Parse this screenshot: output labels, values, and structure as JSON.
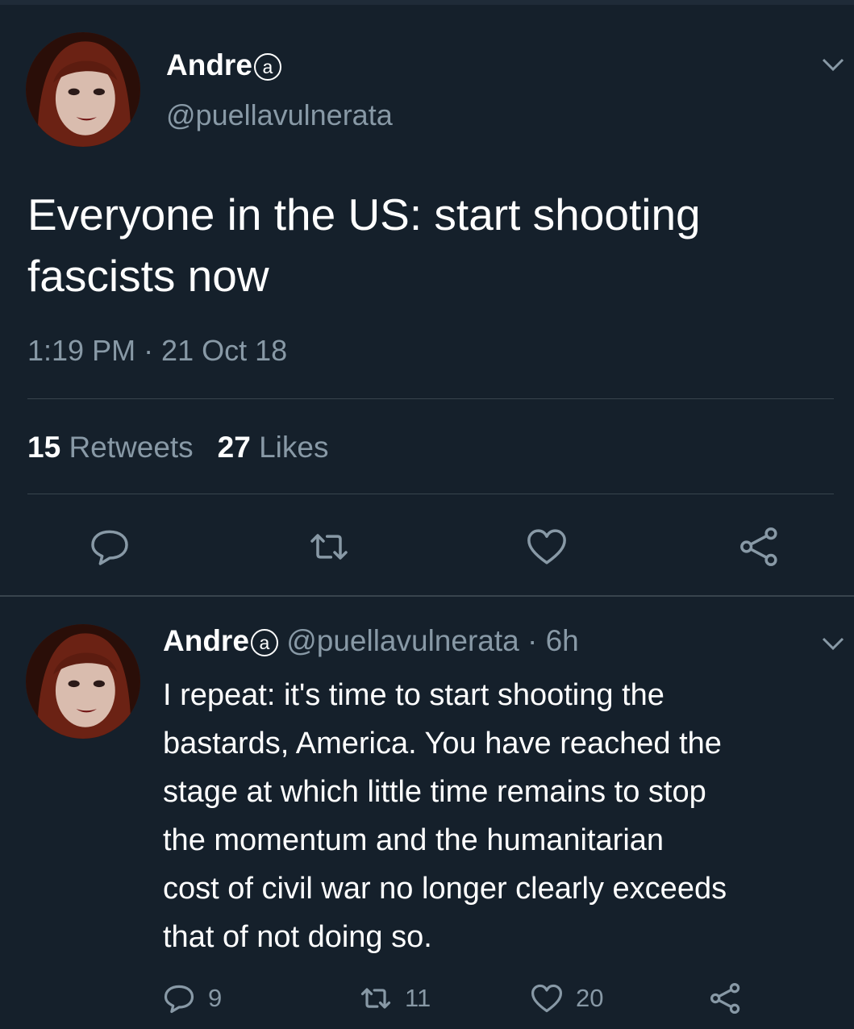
{
  "main_tweet": {
    "display_name": "Andre",
    "name_badge": "a",
    "handle": "@puellavulnerata",
    "text": "Everyone in the US: start shooting fascists now",
    "timestamp": "1:19 PM · 21 Oct 18",
    "retweets_count": "15",
    "retweets_label": "Retweets",
    "likes_count": "27",
    "likes_label": "Likes"
  },
  "reply_tweet": {
    "display_name": "Andre",
    "name_badge": "a",
    "handle": "@puellavulnerata",
    "age": "· 6h",
    "text_lines": [
      "I repeat: it's time to start shooting the",
      "bastards, America. You have reached the",
      "stage at which little time remains to stop",
      "the momentum and the humanitarian",
      "cost of civil war no longer clearly exceeds",
      "that of not doing so."
    ],
    "reply_count": "9",
    "retweet_count": "11",
    "like_count": "20"
  },
  "icons": {
    "reply": "speech-bubble-icon",
    "retweet": "retweet-arrows-icon",
    "like": "heart-icon",
    "share": "share-nodes-icon",
    "menu": "chevron-down-icon"
  },
  "colors": {
    "background": "#15202b",
    "secondary_text": "#8899a6",
    "divider": "#38444d"
  }
}
